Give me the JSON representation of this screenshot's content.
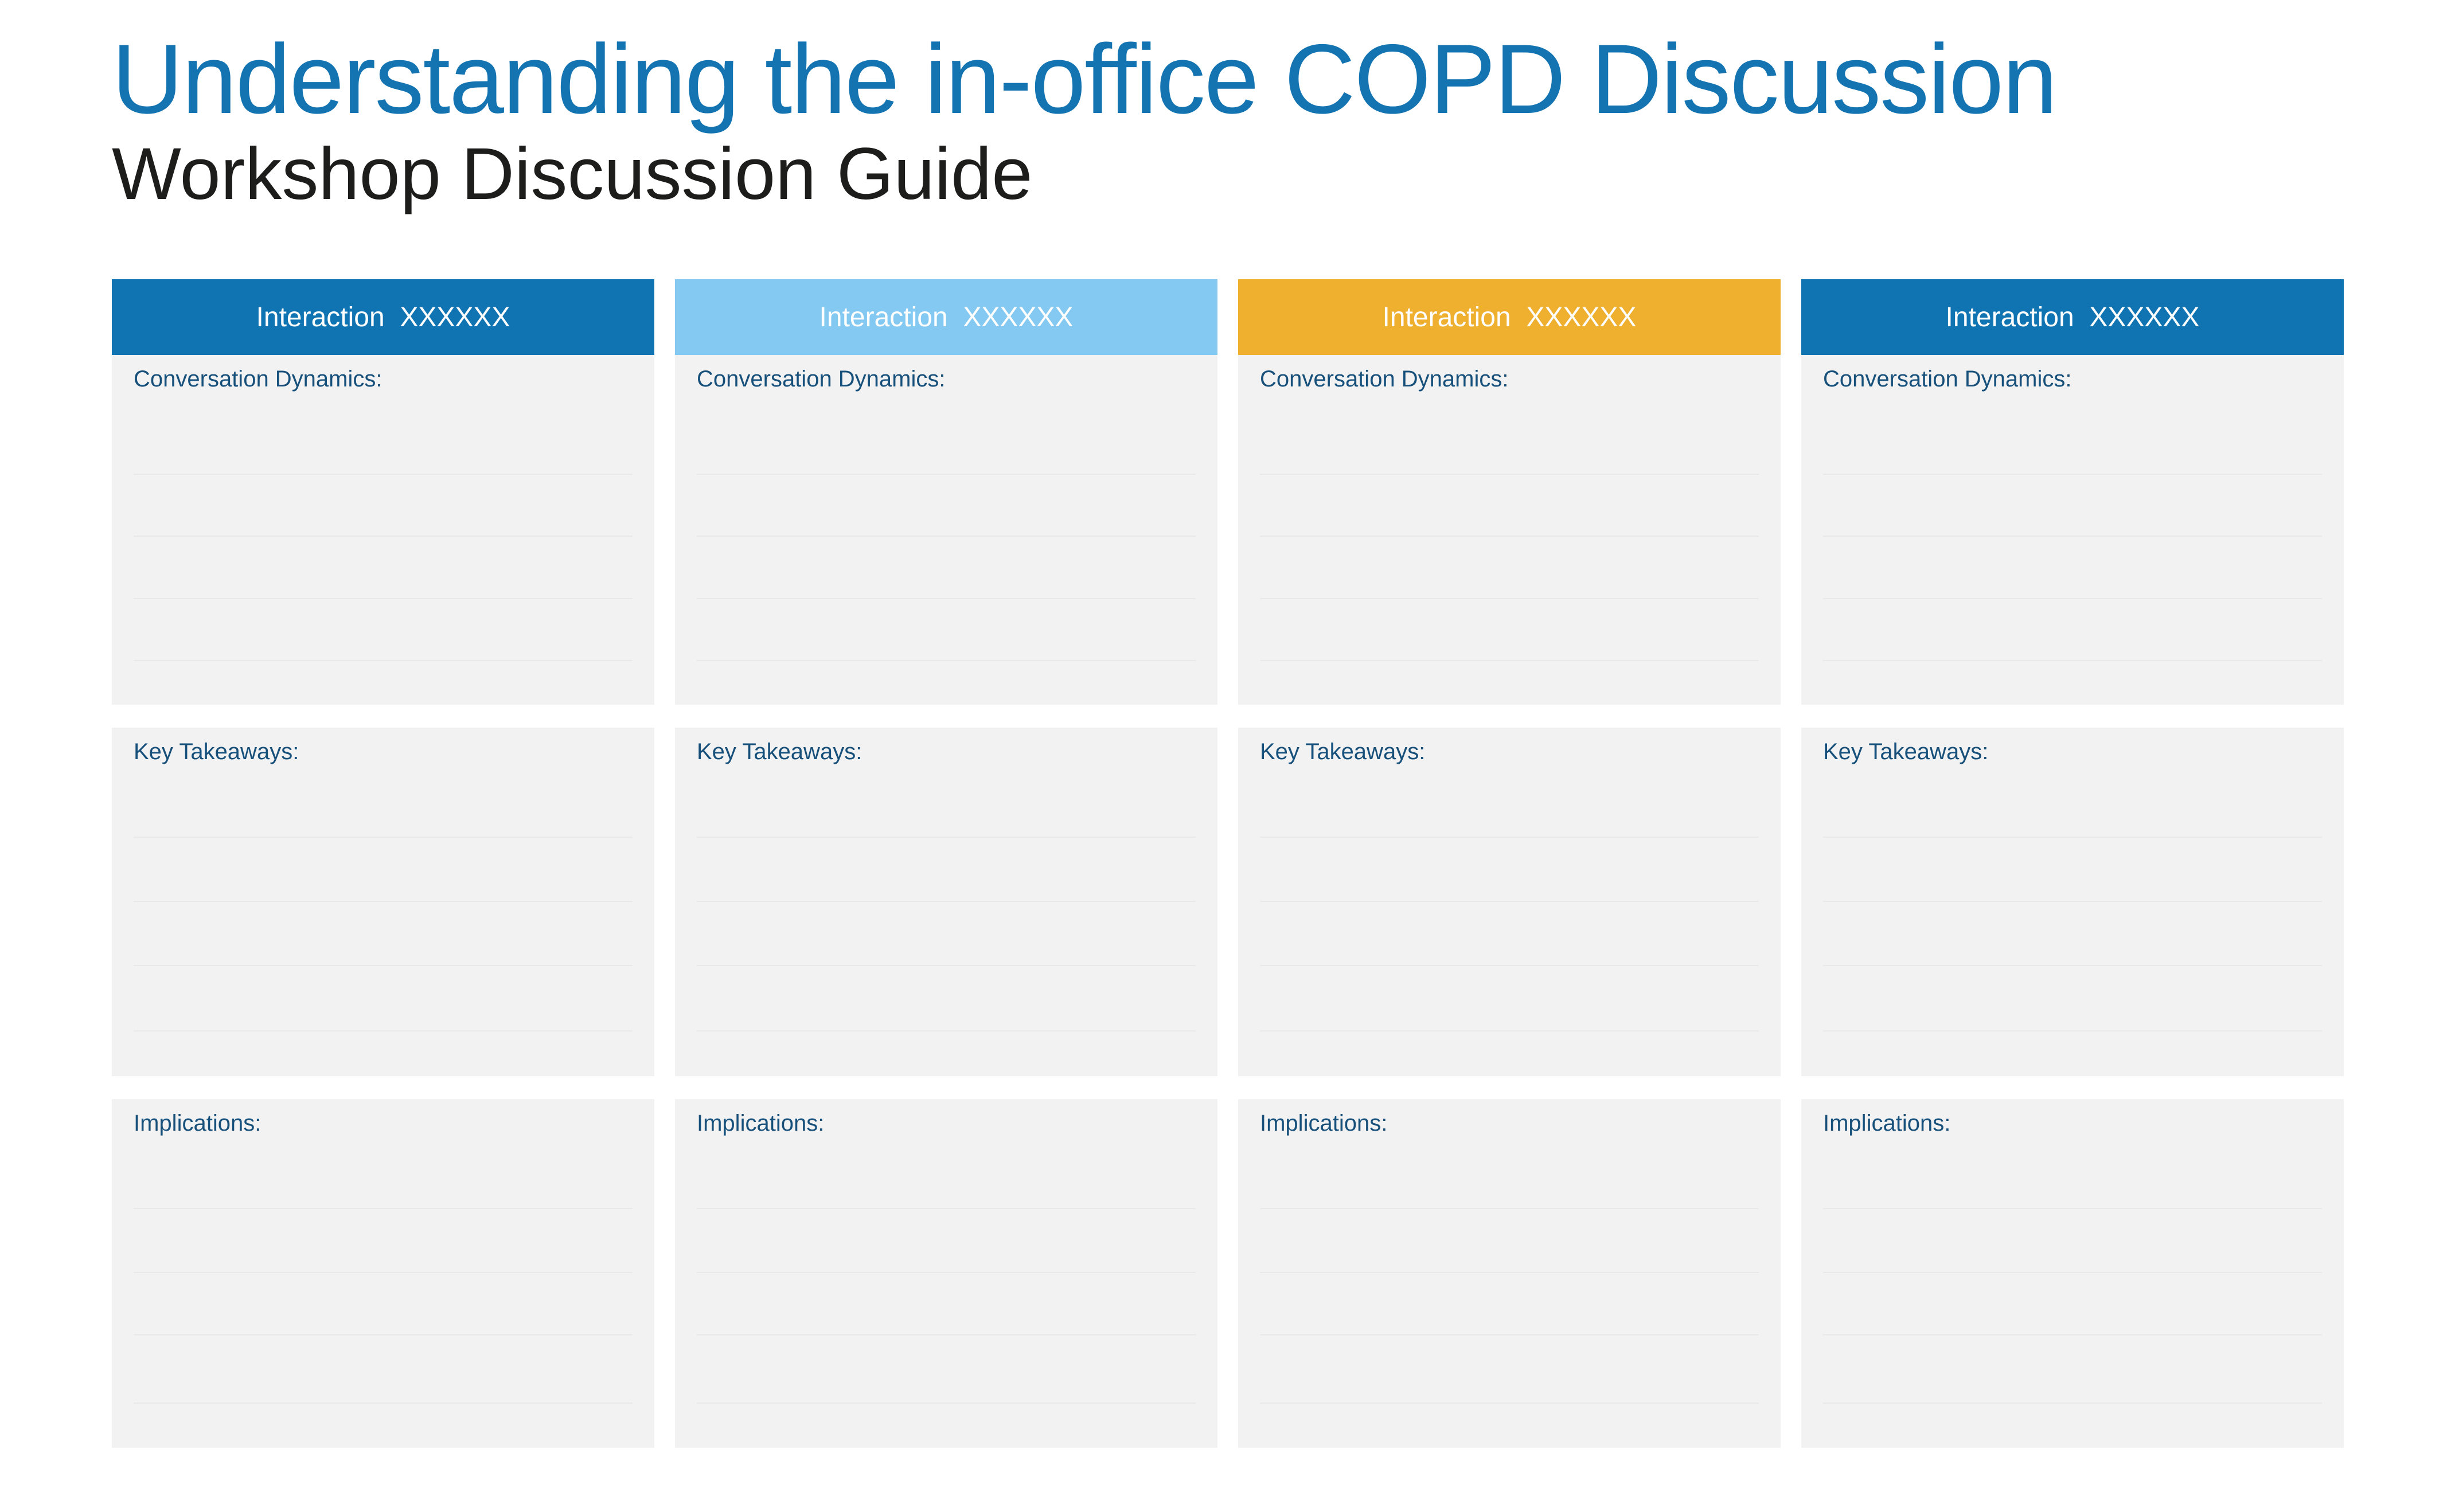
{
  "header": {
    "title": "Understanding the in-office COPD Discussion",
    "subtitle": "Workshop Discussion Guide"
  },
  "colors": {
    "title": "#1474b1",
    "subtitle": "#1d1d1b",
    "label": "#17507a",
    "panel": "#f2f2f2"
  },
  "columns": [
    {
      "header": "Interaction  XXXXXX",
      "color": "#1174b2",
      "sections": [
        "Conversation Dynamics:",
        "Key Takeaways:",
        "Implications:"
      ]
    },
    {
      "header": "Interaction  XXXXXX",
      "color": "#84c9f1",
      "sections": [
        "Conversation Dynamics:",
        "Key Takeaways:",
        "Implications:"
      ]
    },
    {
      "header": "Interaction  XXXXXX",
      "color": "#efaf2f",
      "sections": [
        "Conversation Dynamics:",
        "Key Takeaways:",
        "Implications:"
      ]
    },
    {
      "header": "Interaction  XXXXXX",
      "color": "#1174b2",
      "sections": [
        "Conversation Dynamics:",
        "Key Takeaways:",
        "Implications:"
      ]
    }
  ]
}
